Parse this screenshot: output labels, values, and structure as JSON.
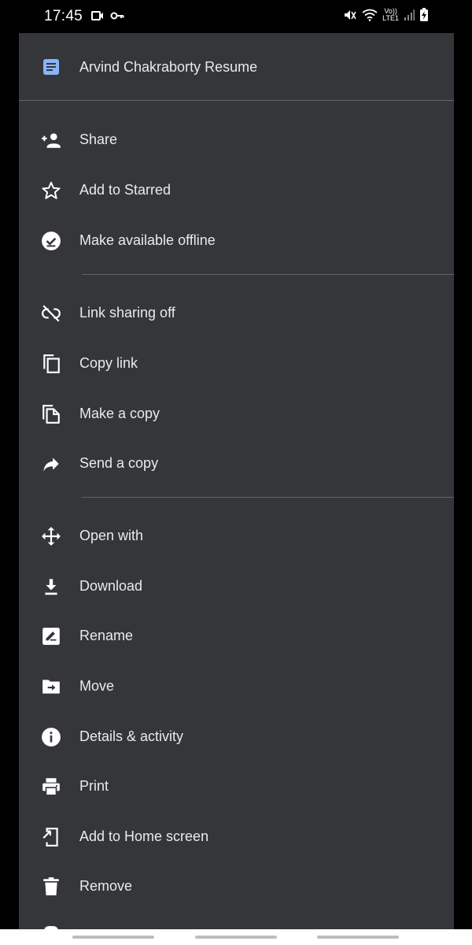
{
  "status_bar": {
    "time": "17:45",
    "left_icons": [
      "video-icon",
      "key-icon"
    ],
    "right_icons": [
      "mute-icon",
      "wifi-icon",
      "volte-icon",
      "signal-icon",
      "battery-charging-icon"
    ],
    "volte_top": "Vo))",
    "volte_bottom": "LTE1"
  },
  "header": {
    "icon": "google-docs-icon",
    "title": "Arvind Chakraborty Resume",
    "accent": "#8ab4f8"
  },
  "menu": {
    "group1": [
      {
        "label": "Share",
        "icon": "person-add-icon"
      },
      {
        "label": "Add to Starred",
        "icon": "star-outline-icon"
      },
      {
        "label": "Make available offline",
        "icon": "offline-check-icon"
      }
    ],
    "group2": [
      {
        "label": "Link sharing off",
        "icon": "link-off-icon"
      },
      {
        "label": "Copy link",
        "icon": "copy-icon"
      },
      {
        "label": "Make a copy",
        "icon": "file-copy-icon"
      },
      {
        "label": "Send a copy",
        "icon": "forward-icon"
      }
    ],
    "group3": [
      {
        "label": "Open with",
        "icon": "open-with-icon"
      },
      {
        "label": "Download",
        "icon": "download-icon"
      },
      {
        "label": "Rename",
        "icon": "rename-icon"
      },
      {
        "label": "Move",
        "icon": "move-folder-icon"
      },
      {
        "label": "Details & activity",
        "icon": "info-icon"
      },
      {
        "label": "Print",
        "icon": "print-icon"
      },
      {
        "label": "Add to Home screen",
        "icon": "add-to-home-icon"
      },
      {
        "label": "Remove",
        "icon": "trash-icon"
      }
    ]
  },
  "colors": {
    "background": "#35363a",
    "text": "#e8eaed",
    "divider": "#5f6368"
  }
}
